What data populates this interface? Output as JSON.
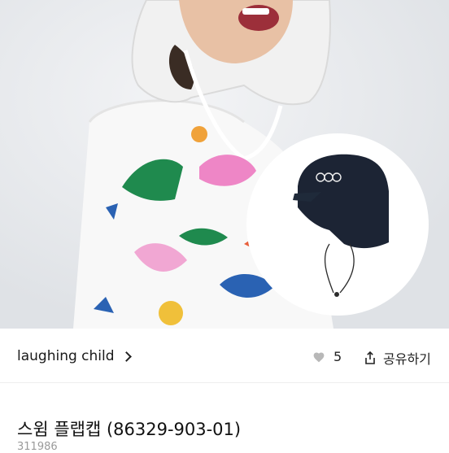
{
  "shop": {
    "name": "laughing child",
    "likes": "5",
    "share_label": "공유하기"
  },
  "product": {
    "title": "스윔 플랩캡 (86329-903-01)",
    "code": "311986"
  },
  "icons": {
    "shop_chevron": "chevron-right-icon",
    "like": "heart-icon",
    "share": "share-icon"
  }
}
